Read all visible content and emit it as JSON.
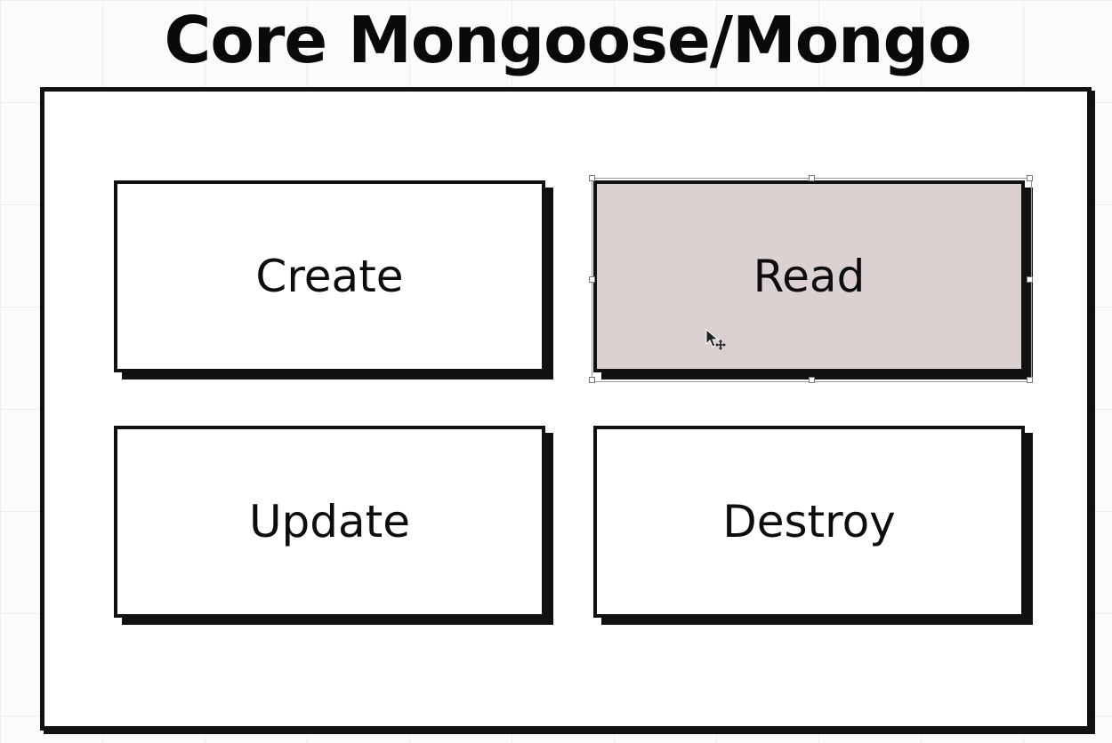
{
  "title": "Core Mongoose/Mongo",
  "operations": [
    {
      "label": "Create"
    },
    {
      "label": "Read"
    },
    {
      "label": "Update"
    },
    {
      "label": "Destroy"
    }
  ],
  "colors": {
    "selected_fill": "#dbd1d0",
    "border": "#111111",
    "background": "#fbfbfb"
  },
  "selected": "Read",
  "icons": {
    "cursor": "move-cursor-icon"
  }
}
